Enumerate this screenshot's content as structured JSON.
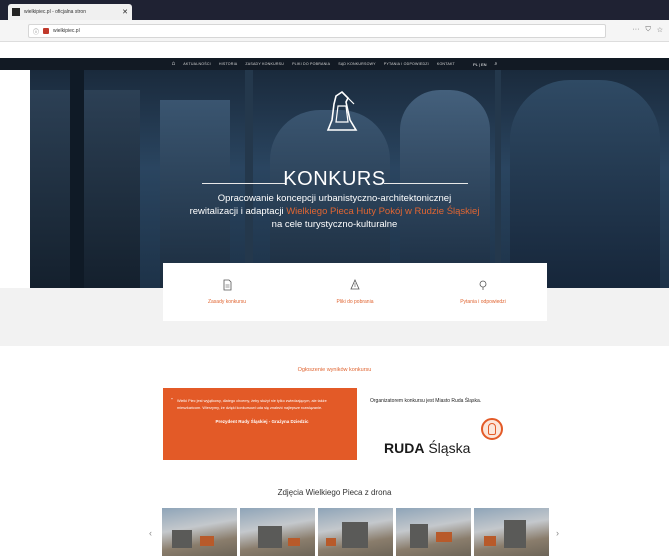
{
  "browser": {
    "tab_title": "wielkipiec.pl - oficjalna stron",
    "tab_close": "✕",
    "url": "wielkipiec.pl",
    "toolbar_icons": [
      "···",
      "☆"
    ]
  },
  "nav": {
    "items": [
      "AKTUALNOŚCI",
      "HISTORIA",
      "ZASADY KONKURSU",
      "PLIKI DO POBRANIA",
      "SĄD KONKURSOWY",
      "PYTANIA I ODPOWIEDZI",
      "KONTAKT"
    ],
    "lang": "PL | EN"
  },
  "hero": {
    "title": "KONKURS",
    "line1": "Opracowanie koncepcji urbanistyczno-architektonicznej",
    "line2_pre": "rewitalizacji i adaptacji ",
    "line2_highlight": "Wielkiego Pieca Huty Pokój w Rudzie Śląskiej",
    "line3": "na cele turystyczno-kulturalne"
  },
  "cards": [
    {
      "label": "Zasady konkursu",
      "icon": "document-icon"
    },
    {
      "label": "Pliki do pobrania",
      "icon": "download-icon"
    },
    {
      "label": "Pytania i odpowiedzi",
      "icon": "question-icon"
    }
  ],
  "results": {
    "link": "Ogłoszenie wyników konkursu"
  },
  "quote": {
    "text": "Wielki Piec jest wyjątkowy, dlatego chcemy, żeby służył nie tylko zwiedzającym, ale także mieszkańcom. Wierzymy, że dzięki konkursowi uda się znaleźć najlepsze rozwiązanie.",
    "author": "Prezydent Rudy Śląskiej - Grażyna Dziedzic"
  },
  "organizer": {
    "text": "Organizatorem konkursu jest Miasto Ruda Śląska.",
    "logo_bold": "RUDA",
    "logo_rest": "Śląska"
  },
  "gallery": {
    "title": "Zdjęcia Wielkiego Pieca z drona",
    "prev": "‹",
    "next": "›",
    "photos": [
      "Zdjęcie 1",
      "Zdjęcie 2",
      "Zdjęcie 3",
      "Zdjęcie 4",
      "Zdjęcie 5"
    ]
  },
  "colors": {
    "accent": "#e35a27",
    "nav_bg": "#121a24",
    "tab_bar": "#1f2233"
  }
}
